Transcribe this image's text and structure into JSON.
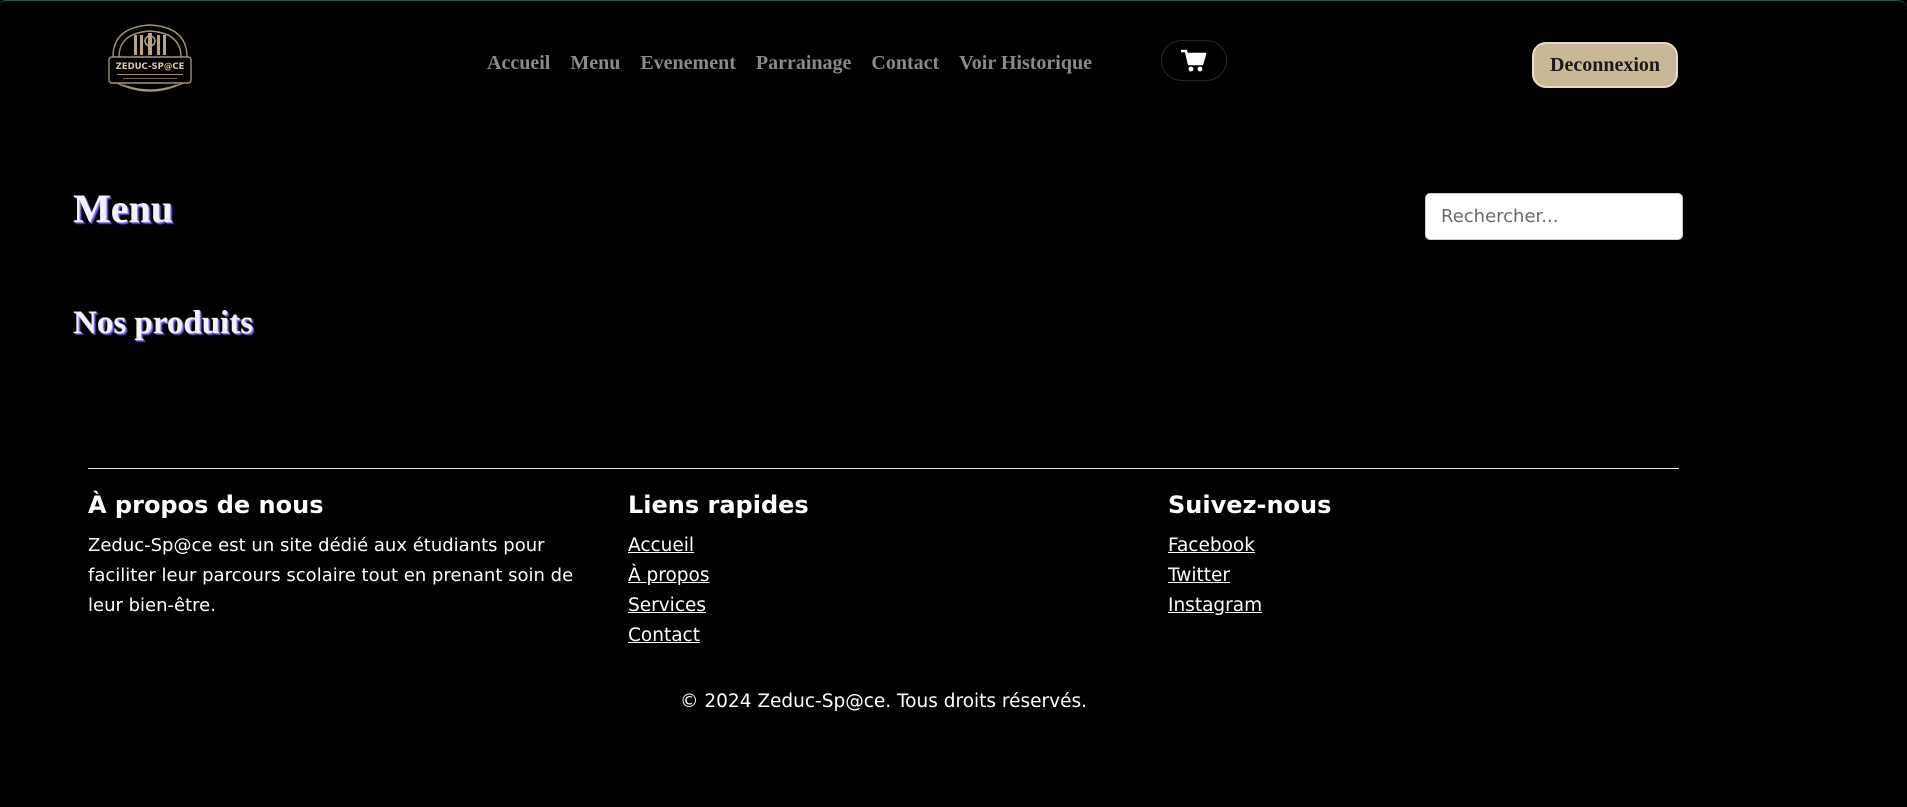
{
  "header": {
    "logo_text": "ZEDUC-SP@CE",
    "nav": [
      "Accueil",
      "Menu",
      "Evenement",
      "Parrainage",
      "Contact",
      "Voir Historique"
    ],
    "cart_icon": "cart-icon",
    "logout_label": "Deconnexion"
  },
  "main": {
    "title": "Menu",
    "search_placeholder": "Rechercher...",
    "section_title": "Nos produits"
  },
  "footer": {
    "about": {
      "title": "À propos de nous",
      "text": "Zeduc-Sp@ce est un site dédié aux étudiants pour faciliter leur parcours scolaire tout en prenant soin de leur bien-être."
    },
    "quick_links": {
      "title": "Liens rapides",
      "links": [
        "Accueil",
        "À propos",
        "Services",
        "Contact"
      ]
    },
    "follow": {
      "title": "Suivez-nous",
      "links": [
        "Facebook",
        "Twitter",
        "Instagram"
      ]
    },
    "copyright": "© 2024 Zeduc-Sp@ce. Tous droits réservés."
  },
  "colors": {
    "background": "#000000",
    "logout_button": "#c9b896",
    "nav_text": "#8a8a8a",
    "title_shadow": "#8f86ff"
  }
}
